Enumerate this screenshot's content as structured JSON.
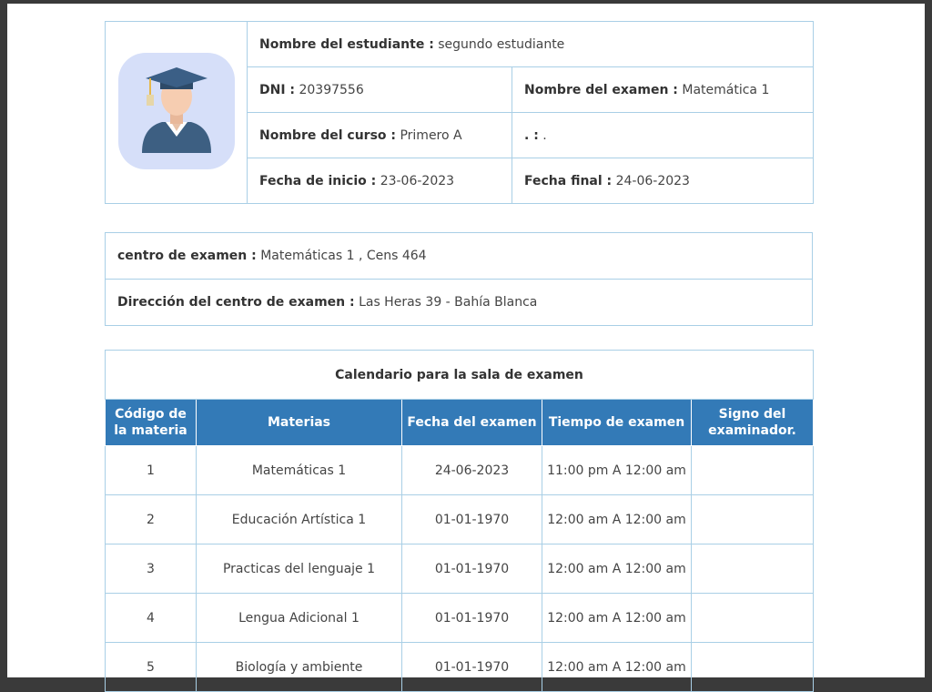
{
  "student": {
    "name_label": "Nombre del estudiante :",
    "name_value": "segundo estudiante",
    "dni_label": "DNI :",
    "dni_value": "20397556",
    "exam_name_label": "Nombre del examen :",
    "exam_name_value": "Matemática 1",
    "course_label": "Nombre del curso :",
    "course_value": "Primero A",
    "extra_label": ". :",
    "extra_value": ".",
    "start_label": "Fecha de inicio :",
    "start_value": "23-06-2023",
    "end_label": "Fecha final :",
    "end_value": "24-06-2023",
    "avatar_icon": "graduate-avatar-icon"
  },
  "center": {
    "center_label": "centro de examen :",
    "center_value": "Matemáticas 1 , Cens 464",
    "address_label": "Dirección del centro de examen :",
    "address_value": "Las Heras 39 - Bahía Blanca"
  },
  "schedule": {
    "caption": "Calendario para la sala de examen",
    "headers": [
      "Código de la materia",
      "Materias",
      "Fecha del examen",
      "Tiempo de examen",
      "Signo del examinador."
    ],
    "rows": [
      {
        "code": "1",
        "subject": "Matemáticas 1",
        "date": "24-06-2023",
        "time": "11:00 pm A 12:00 am",
        "sign": ""
      },
      {
        "code": "2",
        "subject": "Educación Artística 1",
        "date": "01-01-1970",
        "time": "12:00 am A 12:00 am",
        "sign": ""
      },
      {
        "code": "3",
        "subject": "Practicas del lenguaje 1",
        "date": "01-01-1970",
        "time": "12:00 am A 12:00 am",
        "sign": ""
      },
      {
        "code": "4",
        "subject": "Lengua Adicional 1",
        "date": "01-01-1970",
        "time": "12:00 am A 12:00 am",
        "sign": ""
      },
      {
        "code": "5",
        "subject": "Biología y ambiente",
        "date": "01-01-1970",
        "time": "12:00 am A 12:00 am",
        "sign": ""
      }
    ]
  },
  "colors": {
    "header_bg": "#337ab7",
    "border": "#a9cfe6"
  }
}
